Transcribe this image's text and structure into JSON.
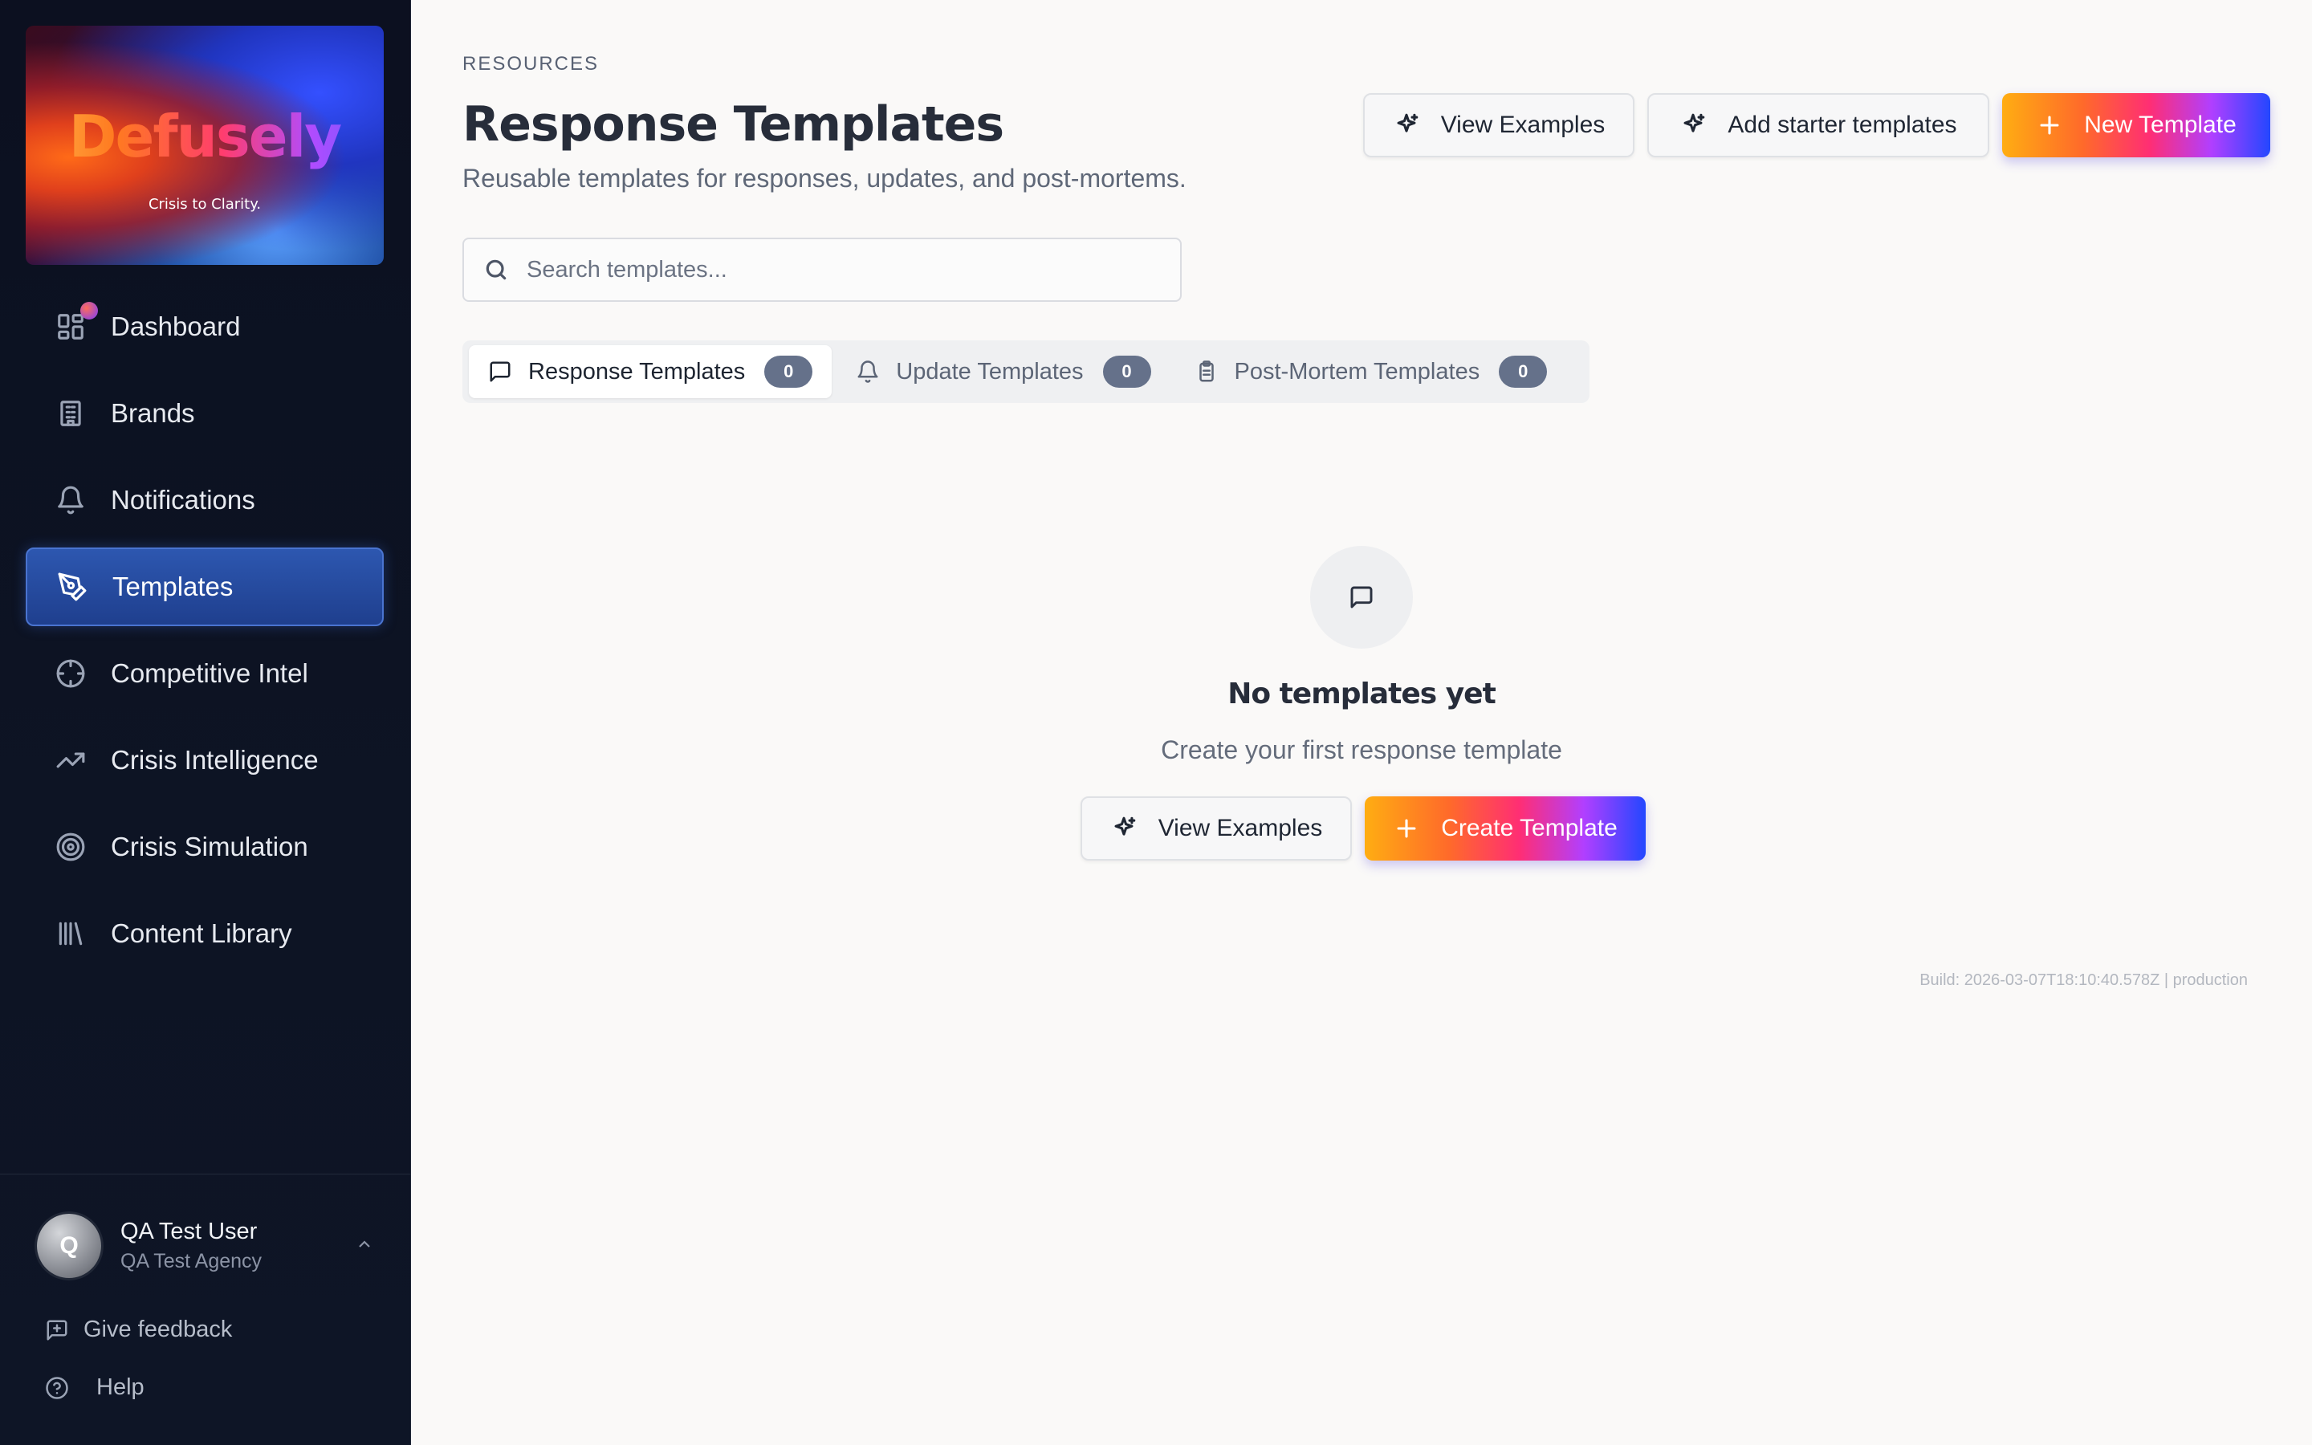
{
  "brand": {
    "wordmark": "Defusely",
    "tagline": "Crisis to Clarity."
  },
  "sidebar": {
    "items": [
      {
        "label": "Dashboard",
        "icon": "dashboard-icon",
        "active": false
      },
      {
        "label": "Brands",
        "icon": "building-icon",
        "active": false
      },
      {
        "label": "Notifications",
        "icon": "bell-icon",
        "active": false
      },
      {
        "label": "Templates",
        "icon": "pen-tool-icon",
        "active": true
      },
      {
        "label": "Competitive Intel",
        "icon": "crosshair-icon",
        "active": false
      },
      {
        "label": "Crisis Intelligence",
        "icon": "trending-up-icon",
        "active": false
      },
      {
        "label": "Crisis Simulation",
        "icon": "target-icon",
        "active": false
      },
      {
        "label": "Content Library",
        "icon": "library-icon",
        "active": false
      }
    ],
    "user": {
      "initial": "Q",
      "name": "QA Test User",
      "org": "QA Test Agency"
    },
    "footer": {
      "feedback_label": "Give feedback",
      "help_label": "Help"
    }
  },
  "header": {
    "eyebrow": "RESOURCES",
    "title": "Response Templates",
    "subtitle": "Reusable templates for responses, updates, and post-mortems.",
    "actions": {
      "view_examples": "View Examples",
      "add_starter": "Add starter templates",
      "new_template": "New Template"
    }
  },
  "search": {
    "placeholder": "Search templates...",
    "value": ""
  },
  "tabs": [
    {
      "label": "Response Templates",
      "count": "0",
      "icon": "message-square-icon",
      "active": true
    },
    {
      "label": "Update Templates",
      "count": "0",
      "icon": "bell-icon",
      "active": false
    },
    {
      "label": "Post-Mortem Templates",
      "count": "0",
      "icon": "clipboard-icon",
      "active": false
    }
  ],
  "empty_state": {
    "icon": "message-square-icon",
    "title": "No templates yet",
    "subtitle": "Create your first response template",
    "view_examples": "View Examples",
    "create_template": "Create Template"
  },
  "build_info": "Build: 2026-03-07T18:10:40.578Z | production",
  "colors": {
    "sidebar_bg": "#0c1020",
    "active_nav": "#2d57b0",
    "accent_gradient": [
      "#ffad12",
      "#ff2e74",
      "#b13fff",
      "#2347ff"
    ],
    "page_bg": "#faf9f8",
    "count_badge": "#65718a"
  }
}
